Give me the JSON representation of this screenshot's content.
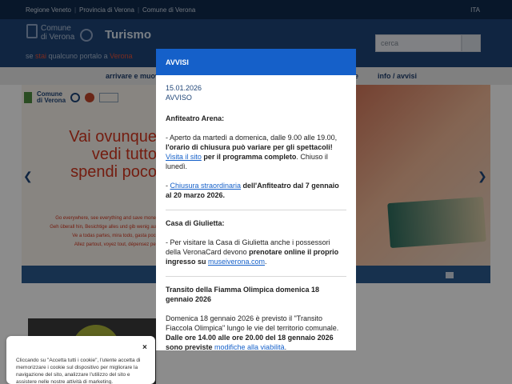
{
  "topbar": {
    "links": [
      "Regione Veneto",
      "Provincia di Verona",
      "Comune di Verona"
    ],
    "lang": "ITA"
  },
  "header": {
    "logo_line1": "Comune",
    "logo_line2": "di Verona",
    "brand": "Turismo",
    "portal_pre": "se ",
    "portal_acc1": "stai",
    "portal_mid": " qualcuno portalo a ",
    "portal_acc2": "Verona",
    "search_placeholder": "cerca"
  },
  "nav": {
    "item1": "arrivare e muoversi",
    "item2": "e",
    "item3": "info / avvisi"
  },
  "hero": {
    "logo_text1": "Comune",
    "logo_text2": "di Verona",
    "slogan_line1": "Vai ovunque",
    "slogan_line2": "vedi tutto",
    "slogan_line3": "spendi poco",
    "sub1": "Go everywhere, see everything and save money",
    "sub2": "Geh überall hin, Besichtige alles und gib wenig aus",
    "sub3": "Ve a todas partes, mira todo, gasta poco",
    "sub4": "Allez partout, voyez tout, dépensez peu"
  },
  "modal": {
    "title": "AVVISI",
    "date": "15.01.2026",
    "kind": "AVVISO",
    "s1_title": "Anfiteatro Arena:",
    "s1_p1_a": "- Aperto da martedì a domenica, dalle 9.00 alle 19.00, ",
    "s1_p1_b": "l'orario di chiusura può variare per gli spettacoli! ",
    "s1_p1_link": "Visita il sito",
    "s1_p1_c": " per il programma completo",
    "s1_p1_d": ". Chiuso il lunedì.",
    "s1_p2_a": "- ",
    "s1_p2_link": "Chiusura straordinaria",
    "s1_p2_b": " dell'Anfiteatro dal 7 gennaio al 20 marzo 2026.",
    "s2_title": "Casa di Giulietta",
    "s2_colon": ":",
    "s2_p_a": "- Per visitare la Casa di Giulietta anche i possessori della VeronaCard devono ",
    "s2_p_b": "prenotare online il proprio ingresso su ",
    "s2_p_link": "museiverona.com",
    "s2_p_c": ".",
    "s3_title": "Transito della Fiamma Olimpica domenica 18 gennaio 2026",
    "s3_p_a": "Domenica 18 gennaio 2026 è previsto il \"Transito Fiaccola Olimpica\" lungo le vie del territorio comunale. ",
    "s3_p_b": "Dalle ore 14.00 alle ore 20.00 del 18 gennaio 2026 sono previste ",
    "s3_p_link": "modifiche alla viabilità",
    "s3_p_c": "."
  },
  "cookie": {
    "text": "Cliccando su \"Accetta tutti i cookie\", l'utente accetta di memorizzare i cookie sul dispositivo per migliorare la navigazione del sito, analizzare l'utilizzo del sito e assistere nelle nostre attività di marketing.",
    "close": "×"
  }
}
